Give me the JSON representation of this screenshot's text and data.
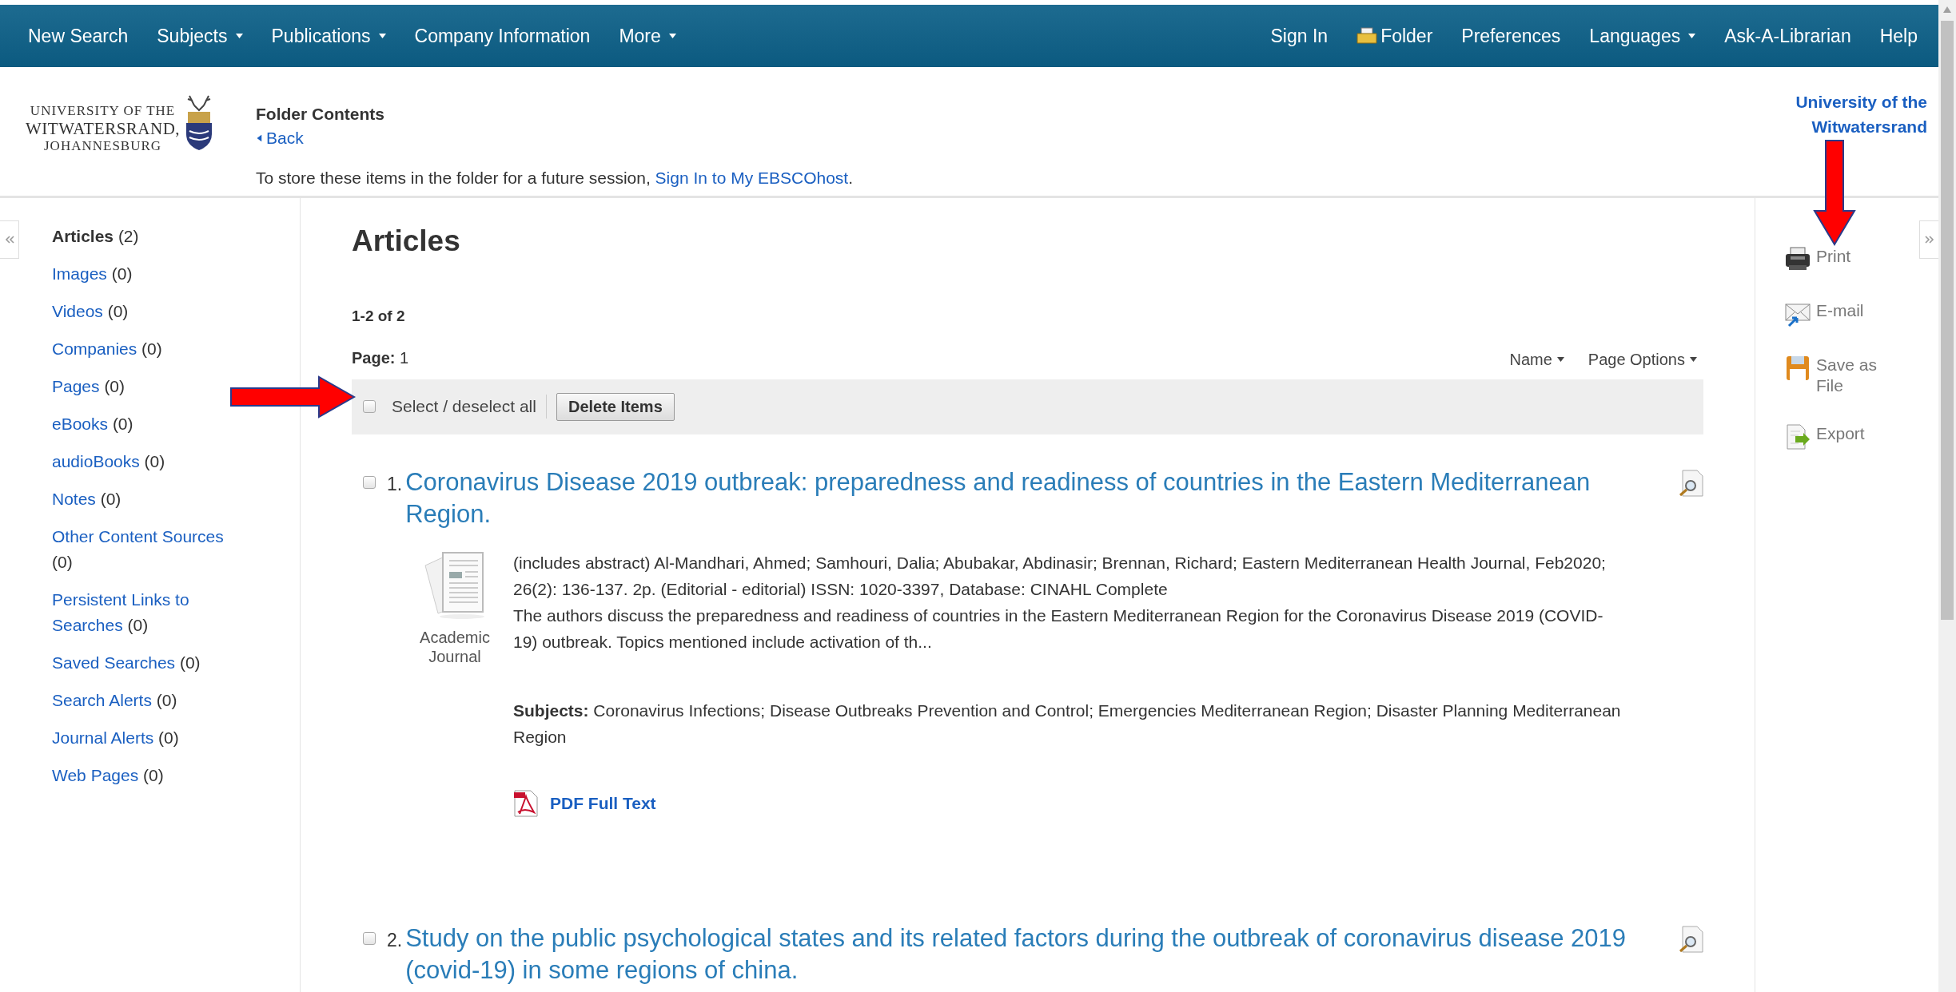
{
  "nav": {
    "left": [
      {
        "label": "New Search",
        "kind": "link"
      },
      {
        "label": "Subjects",
        "kind": "menu"
      },
      {
        "label": "Publications",
        "kind": "menu"
      },
      {
        "label": "Company Information",
        "kind": "link"
      },
      {
        "label": "More",
        "kind": "menu"
      }
    ],
    "right": [
      {
        "label": "Sign In",
        "kind": "link"
      },
      {
        "label": "Folder",
        "kind": "folder"
      },
      {
        "label": "Preferences",
        "kind": "link"
      },
      {
        "label": "Languages",
        "kind": "menu"
      },
      {
        "label": "Ask-A-Librarian",
        "kind": "link"
      },
      {
        "label": "Help",
        "kind": "link"
      }
    ]
  },
  "header": {
    "logo_lines": [
      "UNIVERSITY OF THE",
      "WITWATERSRAND,",
      "JOHANNESBURG"
    ],
    "title": "Folder Contents",
    "back": "Back",
    "notice": "To store these items in the folder for a future session, ",
    "notice_link": "Sign In to My EBSCOhost",
    "notice_end": ".",
    "institution": "University of the Witwatersrand"
  },
  "sidebar": {
    "items": [
      {
        "label": "Articles",
        "count": "(2)",
        "selected": true
      },
      {
        "label": "Images",
        "count": "(0)",
        "selected": false
      },
      {
        "label": "Videos",
        "count": "(0)",
        "selected": false
      },
      {
        "label": "Companies",
        "count": "(0)",
        "selected": false
      },
      {
        "label": "Pages",
        "count": "(0)",
        "selected": false
      },
      {
        "label": "eBooks",
        "count": "(0)",
        "selected": false
      },
      {
        "label": "audioBooks",
        "count": "(0)",
        "selected": false
      },
      {
        "label": "Notes",
        "count": "(0)",
        "selected": false
      },
      {
        "label": "Other Content Sources",
        "count": "(0)",
        "selected": false
      },
      {
        "label": "Persistent Links to Searches",
        "count": "(0)",
        "selected": false
      },
      {
        "label": "Saved Searches",
        "count": "(0)",
        "selected": false
      },
      {
        "label": "Search Alerts",
        "count": "(0)",
        "selected": false
      },
      {
        "label": "Journal Alerts",
        "count": "(0)",
        "selected": false
      },
      {
        "label": "Web Pages",
        "count": "(0)",
        "selected": false
      }
    ]
  },
  "main": {
    "heading": "Articles",
    "range": "1-2 of 2",
    "page_label": "Page:",
    "page": "1",
    "sort": "Name",
    "page_options": "Page Options",
    "select_all": {
      "label": "Select / deselect all",
      "checked": false
    },
    "delete_button": "Delete Items",
    "results": [
      {
        "number": "1.",
        "title": "Coronavirus Disease 2019 outbreak: preparedness and readiness of countries in the Eastern Mediterranean Region.",
        "checked": false,
        "type": "Academic Journal",
        "citation": "(includes abstract) Al-Mandhari, Ahmed; Samhouri, Dalia; Abubakar, Abdinasir; Brennan, Richard; Eastern Mediterranean Health Journal, Feb2020; 26(2): 136-137. 2p. (Editorial - editorial) ISSN: 1020-3397, Database: CINAHL Complete",
        "abstract": "The authors discuss the preparedness and readiness of countries in the Eastern Mediterranean Region for the Coronavirus Disease 2019 (COVID-19) outbreak. Topics mentioned include activation of th...",
        "subjects_label": "Subjects:",
        "subjects": "Coronavirus Infections; Disease Outbreaks Prevention and Control; Emergencies Mediterranean Region; Disaster Planning Mediterranean Region",
        "links": [
          {
            "kind": "pdf",
            "label": "PDF Full Text"
          }
        ]
      },
      {
        "number": "2.",
        "title": "Study on the public psychological states and its related factors during the outbreak of coronavirus disease 2019 (covid-19) in some regions of china.",
        "checked": false
      }
    ]
  },
  "tools": [
    {
      "kind": "print",
      "label": "Print"
    },
    {
      "kind": "email",
      "label": "E-mail"
    },
    {
      "kind": "save",
      "label": "Save as File"
    },
    {
      "kind": "export",
      "label": "Export"
    }
  ]
}
